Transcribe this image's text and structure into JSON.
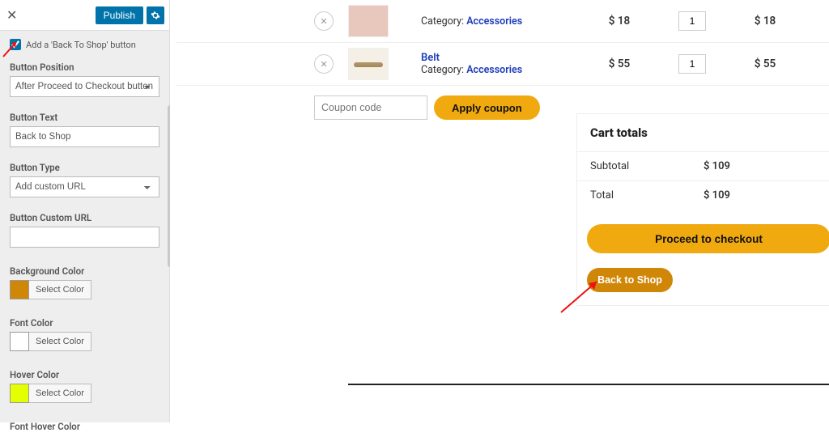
{
  "topbar": {
    "publish": "Publish"
  },
  "checkbox_label": "Add a 'Back To Shop' button",
  "fields": {
    "position": {
      "label": "Button Position",
      "value": "After Proceed to Checkout button"
    },
    "text": {
      "label": "Button Text",
      "value": "Back to Shop"
    },
    "type": {
      "label": "Button Type",
      "value": "Add custom URL"
    },
    "url": {
      "label": "Button Custom URL",
      "value": ""
    },
    "bg": {
      "label": "Background Color",
      "btn": "Select Color",
      "swatch": "#d08708"
    },
    "font": {
      "label": "Font Color",
      "btn": "Select Color",
      "swatch": "#ffffff"
    },
    "hover": {
      "label": "Hover Color",
      "btn": "Select Color",
      "swatch": "#e4ff00"
    },
    "fhover": {
      "label": "Font Hover Color"
    }
  },
  "cart": {
    "rows": [
      {
        "title": "",
        "cat_label": "Category:",
        "cat": "Accessories",
        "price": "$ 18",
        "qty": "1",
        "sub": "$ 18"
      },
      {
        "title": "Belt",
        "cat_label": "Category:",
        "cat": "Accessories",
        "price": "$ 55",
        "qty": "1",
        "sub": "$ 55"
      }
    ],
    "coupon_placeholder": "Coupon code",
    "apply": "Apply coupon"
  },
  "totals": {
    "heading": "Cart totals",
    "subtotal_label": "Subtotal",
    "subtotal": "$ 109",
    "total_label": "Total",
    "total": "$ 109",
    "proceed": "Proceed to checkout",
    "back": "Back to Shop"
  }
}
